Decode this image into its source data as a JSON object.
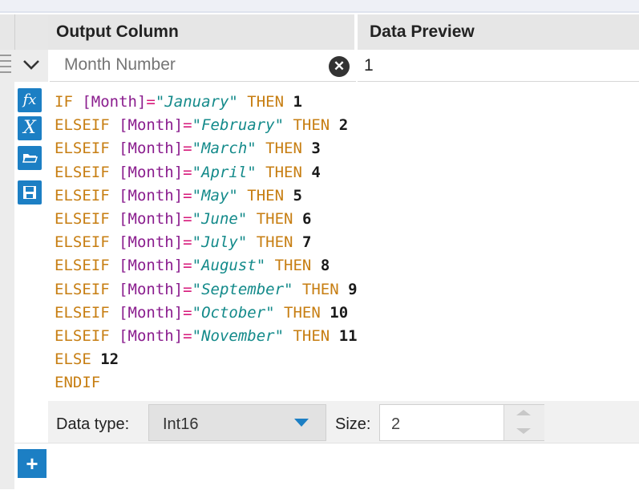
{
  "header": {
    "output_column": "Output Column",
    "data_preview": "Data Preview"
  },
  "field": {
    "placeholder": "Month Number",
    "clear_icon": "clear-circle-icon",
    "preview_value": "1"
  },
  "toolbar_icons": [
    "function-icon",
    "variable-icon",
    "open-folder-icon",
    "save-icon"
  ],
  "toolbar_glyphs": {
    "function": "fx",
    "variable": "X"
  },
  "expression": [
    [
      {
        "t": "IF",
        "c": "kw"
      },
      {
        "t": " "
      },
      {
        "t": "[Month]",
        "c": "fld"
      },
      {
        "t": "=",
        "c": "op"
      },
      {
        "t": "\"January\"",
        "c": "str"
      },
      {
        "t": " "
      },
      {
        "t": "THEN",
        "c": "kw"
      },
      {
        "t": " "
      },
      {
        "t": "1",
        "c": "num"
      }
    ],
    [
      {
        "t": "ELSEIF",
        "c": "kw"
      },
      {
        "t": " "
      },
      {
        "t": "[Month]",
        "c": "fld"
      },
      {
        "t": "=",
        "c": "op"
      },
      {
        "t": "\"February\"",
        "c": "str"
      },
      {
        "t": " "
      },
      {
        "t": "THEN",
        "c": "kw"
      },
      {
        "t": " "
      },
      {
        "t": "2",
        "c": "num"
      }
    ],
    [
      {
        "t": "ELSEIF",
        "c": "kw"
      },
      {
        "t": " "
      },
      {
        "t": "[Month]",
        "c": "fld"
      },
      {
        "t": "=",
        "c": "op"
      },
      {
        "t": "\"March\"",
        "c": "str"
      },
      {
        "t": " "
      },
      {
        "t": "THEN",
        "c": "kw"
      },
      {
        "t": " "
      },
      {
        "t": "3",
        "c": "num"
      }
    ],
    [
      {
        "t": "ELSEIF",
        "c": "kw"
      },
      {
        "t": " "
      },
      {
        "t": "[Month]",
        "c": "fld"
      },
      {
        "t": "=",
        "c": "op"
      },
      {
        "t": "\"April\"",
        "c": "str"
      },
      {
        "t": " "
      },
      {
        "t": "THEN",
        "c": "kw"
      },
      {
        "t": " "
      },
      {
        "t": "4",
        "c": "num"
      }
    ],
    [
      {
        "t": "ELSEIF",
        "c": "kw"
      },
      {
        "t": " "
      },
      {
        "t": "[Month]",
        "c": "fld"
      },
      {
        "t": "=",
        "c": "op"
      },
      {
        "t": "\"May\"",
        "c": "str"
      },
      {
        "t": " "
      },
      {
        "t": "THEN",
        "c": "kw"
      },
      {
        "t": " "
      },
      {
        "t": "5",
        "c": "num"
      }
    ],
    [
      {
        "t": "ELSEIF",
        "c": "kw"
      },
      {
        "t": " "
      },
      {
        "t": "[Month]",
        "c": "fld"
      },
      {
        "t": "=",
        "c": "op"
      },
      {
        "t": "\"June\"",
        "c": "str"
      },
      {
        "t": " "
      },
      {
        "t": "THEN",
        "c": "kw"
      },
      {
        "t": " "
      },
      {
        "t": "6",
        "c": "num"
      }
    ],
    [
      {
        "t": "ELSEIF",
        "c": "kw"
      },
      {
        "t": " "
      },
      {
        "t": "[Month]",
        "c": "fld"
      },
      {
        "t": "=",
        "c": "op"
      },
      {
        "t": "\"July\"",
        "c": "str"
      },
      {
        "t": " "
      },
      {
        "t": "THEN",
        "c": "kw"
      },
      {
        "t": " "
      },
      {
        "t": "7",
        "c": "num"
      }
    ],
    [
      {
        "t": "ELSEIF",
        "c": "kw"
      },
      {
        "t": " "
      },
      {
        "t": "[Month]",
        "c": "fld"
      },
      {
        "t": "=",
        "c": "op"
      },
      {
        "t": "\"August\"",
        "c": "str"
      },
      {
        "t": " "
      },
      {
        "t": "THEN",
        "c": "kw"
      },
      {
        "t": " "
      },
      {
        "t": "8",
        "c": "num"
      }
    ],
    [
      {
        "t": "ELSEIF",
        "c": "kw"
      },
      {
        "t": " "
      },
      {
        "t": "[Month]",
        "c": "fld"
      },
      {
        "t": "=",
        "c": "op"
      },
      {
        "t": "\"September\"",
        "c": "str"
      },
      {
        "t": " "
      },
      {
        "t": "THEN",
        "c": "kw"
      },
      {
        "t": " "
      },
      {
        "t": "9",
        "c": "num"
      }
    ],
    [
      {
        "t": "ELSEIF",
        "c": "kw"
      },
      {
        "t": " "
      },
      {
        "t": "[Month]",
        "c": "fld"
      },
      {
        "t": "=",
        "c": "op"
      },
      {
        "t": "\"October\"",
        "c": "str"
      },
      {
        "t": " "
      },
      {
        "t": "THEN",
        "c": "kw"
      },
      {
        "t": " "
      },
      {
        "t": "10",
        "c": "num"
      }
    ],
    [
      {
        "t": "ELSEIF",
        "c": "kw"
      },
      {
        "t": " "
      },
      {
        "t": "[Month]",
        "c": "fld"
      },
      {
        "t": "=",
        "c": "op"
      },
      {
        "t": "\"November\"",
        "c": "str"
      },
      {
        "t": " "
      },
      {
        "t": "THEN",
        "c": "kw"
      },
      {
        "t": " "
      },
      {
        "t": "11",
        "c": "num"
      }
    ],
    [
      {
        "t": "ELSE",
        "c": "kw"
      },
      {
        "t": " "
      },
      {
        "t": "12",
        "c": "num"
      }
    ],
    [
      {
        "t": "ENDIF",
        "c": "kw"
      }
    ]
  ],
  "footer": {
    "data_type_label": "Data type:",
    "data_type_value": "Int16",
    "size_label": "Size:",
    "size_value": "2"
  },
  "add_button": "+",
  "colors": {
    "accent": "#1c7fc4",
    "keyword": "#c77e12",
    "field": "#8a1d8e",
    "operator": "#d6197a",
    "string": "#138a8a"
  }
}
